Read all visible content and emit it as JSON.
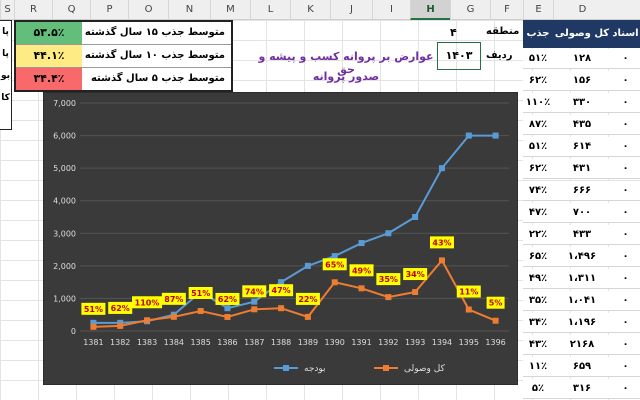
{
  "spreadsheet": {
    "columns": [
      "S",
      "R",
      "Q",
      "P",
      "O",
      "N",
      "M",
      "L",
      "K",
      "J",
      "I",
      "H",
      "G",
      "F",
      "E",
      "D"
    ],
    "selected_column": "H",
    "left_fragment": [
      "پا",
      "پا",
      "بو",
      "کا"
    ],
    "averages": [
      {
        "label": "متوسط جذب ۱۵ سال گذشته",
        "value": "۵۳.۵٪",
        "color": "#63be7b"
      },
      {
        "label": "متوسط جذب ۱۰ سال گذشته",
        "value": "۴۴.۱٪",
        "color": "#ffeb84"
      },
      {
        "label": "متوسط جذب ۵ سال گذشته",
        "value": "۳۴.۴٪",
        "color": "#f8696b"
      }
    ],
    "mantaghe_label": "منطقه",
    "mantaghe_value": "۴",
    "radif_label": "ردیف",
    "radif_value": "۱۴۰۳",
    "title_line1": "عوارض بر پروانه کسب و پیشه و حق",
    "title_line2": "صدور پروانه"
  },
  "table": {
    "headers": {
      "asnad": "اسناد",
      "kol_vosooli": "کل وصولی",
      "jazb": "جذب"
    },
    "rows": [
      {
        "d": "۰",
        "e": "۱۲۸",
        "f": "۵۱٪"
      },
      {
        "d": "۰",
        "e": "۱۵۶",
        "f": "۶۲٪"
      },
      {
        "d": "۰",
        "e": "۳۳۰",
        "f": "۱۱۰٪"
      },
      {
        "d": "۰",
        "e": "۴۳۵",
        "f": "۸۷٪"
      },
      {
        "d": "۰",
        "e": "۶۱۴",
        "f": "۵۱٪"
      },
      {
        "d": "۰",
        "e": "۴۳۱",
        "f": "۶۲٪"
      },
      {
        "d": "۰",
        "e": "۶۶۶",
        "f": "۷۴٪"
      },
      {
        "d": "۰",
        "e": "۷۰۰",
        "f": "۴۷٪"
      },
      {
        "d": "۰",
        "e": "۴۳۳",
        "f": "۲۲٪"
      },
      {
        "d": "۰",
        "e": "۱،۴۹۶",
        "f": "۶۵٪"
      },
      {
        "d": "۰",
        "e": "۱،۳۱۱",
        "f": "۴۹٪"
      },
      {
        "d": "۰",
        "e": "۱،۰۴۱",
        "f": "۳۵٪"
      },
      {
        "d": "۰",
        "e": "۱،۱۹۶",
        "f": "۳۴٪"
      },
      {
        "d": "۰",
        "e": "۲۱۶۸",
        "f": "۴۳٪"
      },
      {
        "d": "۰",
        "e": "۶۵۹",
        "f": "۱۱٪"
      },
      {
        "d": "۰",
        "e": "۳۱۶",
        "f": "۵٪"
      }
    ]
  },
  "chart_data": {
    "type": "line",
    "categories": [
      "1381",
      "1382",
      "1383",
      "1384",
      "1385",
      "1386",
      "1387",
      "1388",
      "1389",
      "1390",
      "1391",
      "1392",
      "1393",
      "1394",
      "1395",
      "1396"
    ],
    "series": [
      {
        "name": "بودجه",
        "color": "#5b9bd5",
        "values": [
          250,
          250,
          300,
          500,
          1200,
          700,
          900,
          1500,
          2000,
          2300,
          2700,
          3000,
          3500,
          5000,
          6000,
          6000
        ]
      },
      {
        "name": "کل وصولی",
        "color": "#ed7d31",
        "values": [
          128,
          156,
          330,
          435,
          614,
          431,
          666,
          700,
          433,
          1496,
          1311,
          1041,
          1196,
          2168,
          659,
          316
        ]
      }
    ],
    "data_labels": [
      "51%",
      "62%",
      "110%",
      "87%",
      "51%",
      "62%",
      "74%",
      "47%",
      "22%",
      "65%",
      "49%",
      "35%",
      "34%",
      "43%",
      "11%",
      "5%"
    ],
    "yticks": [
      "0",
      "1,000",
      "2,000",
      "3,000",
      "4,000",
      "5,000",
      "6,000",
      "7,000"
    ],
    "ylim": [
      0,
      7000
    ],
    "grid": true,
    "legend_position": "bottom"
  }
}
